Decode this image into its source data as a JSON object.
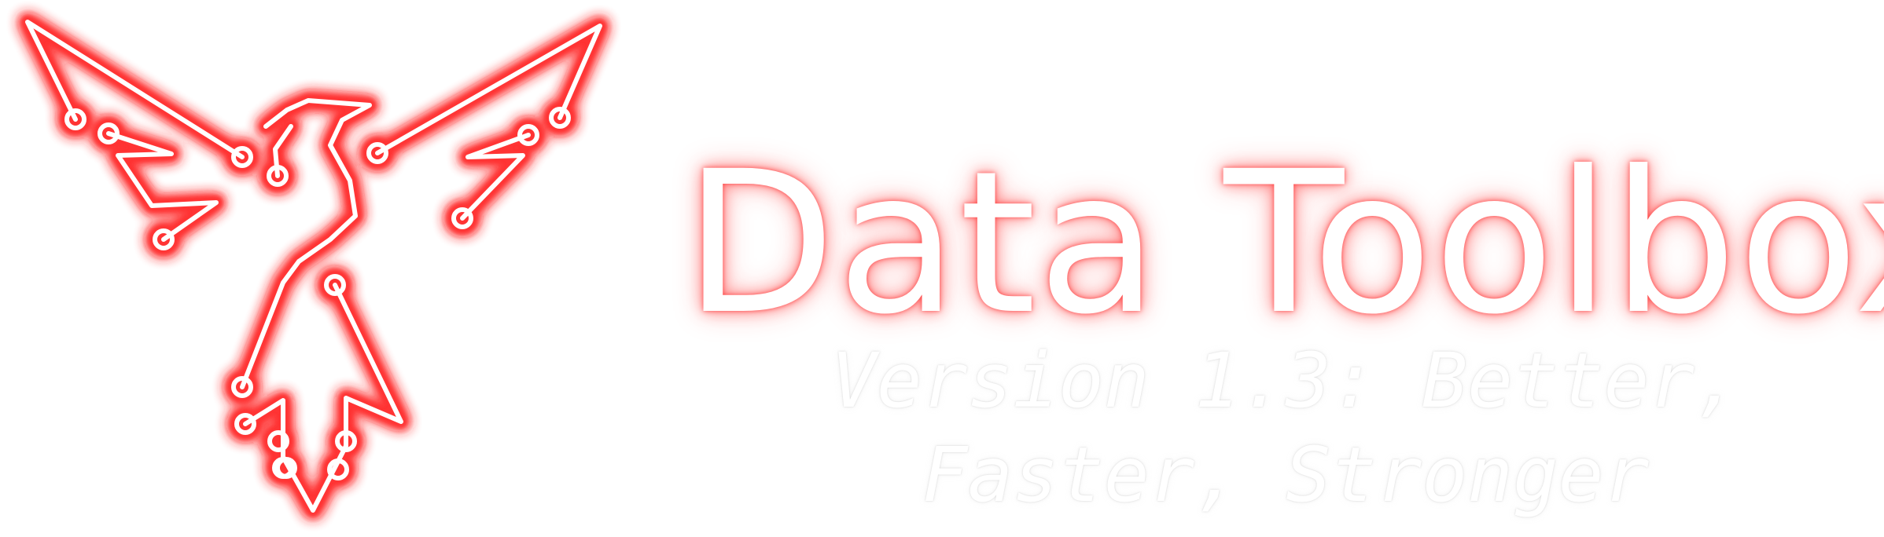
{
  "brand": {
    "logo_icon": "circuit-phoenix-icon",
    "title": "Data Toolbox",
    "subtitle": "Version 1.3: Better, Faster, Stronger"
  },
  "colors": {
    "background": "#ffffff",
    "glow": "#ff2a2a",
    "line": "#ffffff"
  }
}
